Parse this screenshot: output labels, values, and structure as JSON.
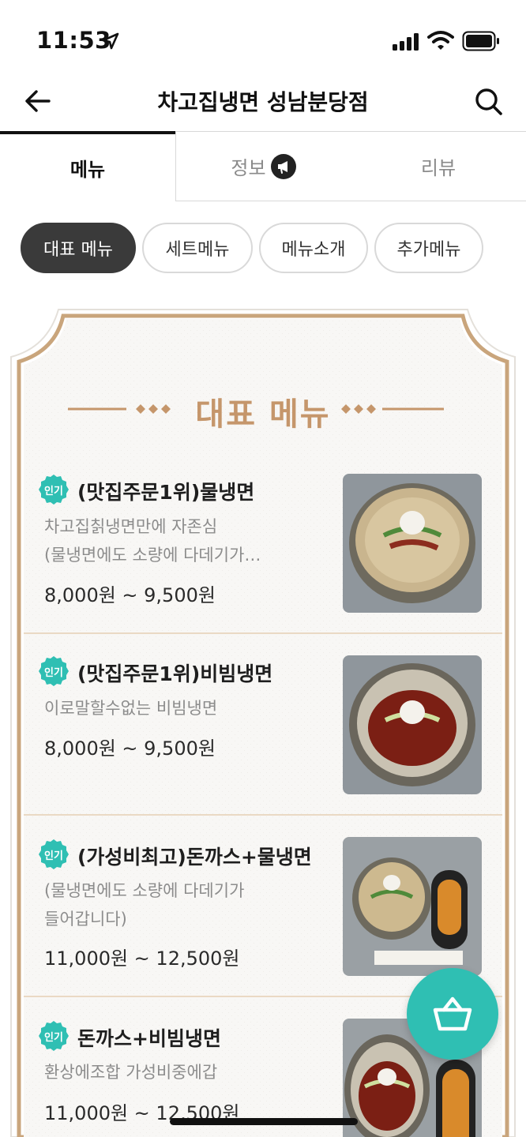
{
  "status": {
    "time": "11:53"
  },
  "header": {
    "title": "차고집냉면 성남분당점"
  },
  "tabs": [
    {
      "label": "메뉴",
      "active": true
    },
    {
      "label": "정보",
      "active": false
    },
    {
      "label": "리뷰",
      "active": false
    }
  ],
  "chips": [
    {
      "label": "대표 메뉴",
      "active": true
    },
    {
      "label": "세트메뉴",
      "active": false
    },
    {
      "label": "메뉴소개",
      "active": false
    },
    {
      "label": "추가메뉴",
      "active": false
    }
  ],
  "section": {
    "title": "대표 메뉴"
  },
  "badge_label": "인기",
  "menu_items": [
    {
      "name": "(맛집주문1위)물냉면",
      "desc": "차고집칡냉면만에 자존심\n(물냉면에도 소량에 다데기가…",
      "price": "8,000원 ~ 9,500원",
      "photo": "mul-naengmyeon"
    },
    {
      "name": "(맛집주문1위)비빔냉면",
      "desc": "이로말할수없는 비빔냉면",
      "price": "8,000원 ~ 9,500원",
      "photo": "bibim-naengmyeon"
    },
    {
      "name": "(가성비최고)돈까스+물냉면",
      "desc": "(물냉면에도 소량에 다데기가\n들어갑니다)",
      "price": "11,000원 ~ 12,500원",
      "photo": "donkatsu-mul-naengmyeon"
    },
    {
      "name": "돈까스+비빔냉면",
      "desc": "환상에조합 가성비중에갑",
      "price": "11,000원 ~ 12,500원",
      "photo": "donkatsu-bibim-naengmyeon"
    }
  ],
  "colors": {
    "accent_teal": "#2fbfb3",
    "gold": "#c5966b",
    "chip_active": "#3a3a3a"
  },
  "icons": {
    "back": "arrow-left-icon",
    "search": "search-icon",
    "cart": "basket-icon",
    "info_badge": "megaphone-icon"
  }
}
